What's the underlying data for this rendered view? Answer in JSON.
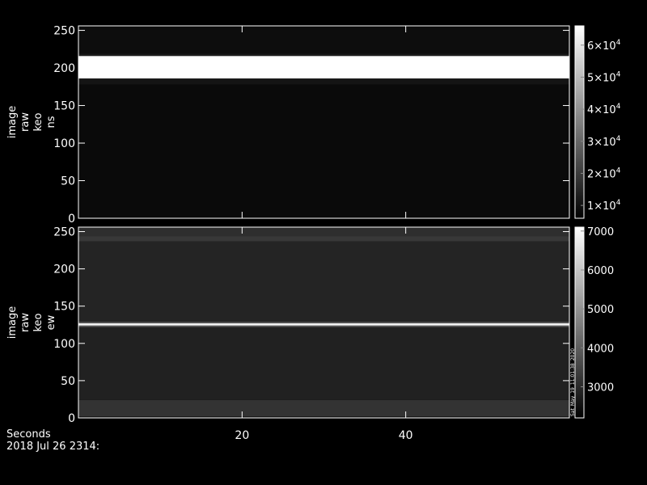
{
  "chart_data": [
    {
      "type": "heatmap",
      "panel": "top",
      "ylabel": [
        "image",
        "raw",
        "keo",
        "ns"
      ],
      "ylim": [
        0,
        256
      ],
      "yticks": [
        0,
        50,
        100,
        150,
        200,
        250
      ],
      "xlim": [
        0,
        60
      ],
      "colorbar": {
        "range": [
          6000,
          66000
        ],
        "ticks": [
          10000,
          20000,
          30000,
          40000,
          50000,
          60000
        ],
        "tick_labels": [
          {
            "mantissa": "1",
            "base": "10",
            "exp": "4"
          },
          {
            "mantissa": "2",
            "base": "10",
            "exp": "4"
          },
          {
            "mantissa": "3",
            "base": "10",
            "exp": "4"
          },
          {
            "mantissa": "4",
            "base": "10",
            "exp": "4"
          },
          {
            "mantissa": "5",
            "base": "10",
            "exp": "4"
          },
          {
            "mantissa": "6",
            "base": "10",
            "exp": "4"
          }
        ]
      },
      "bands": [
        {
          "y0": 0,
          "y1": 178,
          "level": 0.04
        },
        {
          "y0": 178,
          "y1": 186,
          "level": 0.08
        },
        {
          "y0": 186,
          "y1": 216,
          "level": 1.0
        },
        {
          "y0": 216,
          "y1": 219,
          "level": 0.1
        },
        {
          "y0": 219,
          "y1": 256,
          "level": 0.05
        }
      ]
    },
    {
      "type": "heatmap",
      "panel": "bottom",
      "ylabel": [
        "image",
        "raw",
        "keo",
        "ew"
      ],
      "ylim": [
        0,
        256
      ],
      "yticks": [
        0,
        50,
        100,
        150,
        200,
        250
      ],
      "xlim": [
        0,
        60
      ],
      "xticks": [
        20,
        40
      ],
      "colorbar": {
        "range": [
          2200,
          7100
        ],
        "ticks": [
          3000,
          4000,
          5000,
          6000,
          7000
        ],
        "tick_labels": [
          "3000",
          "4000",
          "5000",
          "6000",
          "7000"
        ]
      },
      "bands": [
        {
          "y0": 0,
          "y1": 2,
          "level": 0.1
        },
        {
          "y0": 2,
          "y1": 24,
          "level": 0.2
        },
        {
          "y0": 24,
          "y1": 122,
          "level": 0.13
        },
        {
          "y0": 122,
          "y1": 124,
          "level": 0.35
        },
        {
          "y0": 124,
          "y1": 127,
          "level": 0.95
        },
        {
          "y0": 127,
          "y1": 129,
          "level": 0.35
        },
        {
          "y0": 129,
          "y1": 237,
          "level": 0.14
        },
        {
          "y0": 237,
          "y1": 244,
          "level": 0.22
        },
        {
          "y0": 244,
          "y1": 256,
          "level": 0.18
        }
      ],
      "colorbar_annotation": "Sat_May_19_11:01:38_2020"
    }
  ],
  "footer": {
    "xlabel": "Seconds",
    "date": "2018 Jul 26 2314:"
  }
}
